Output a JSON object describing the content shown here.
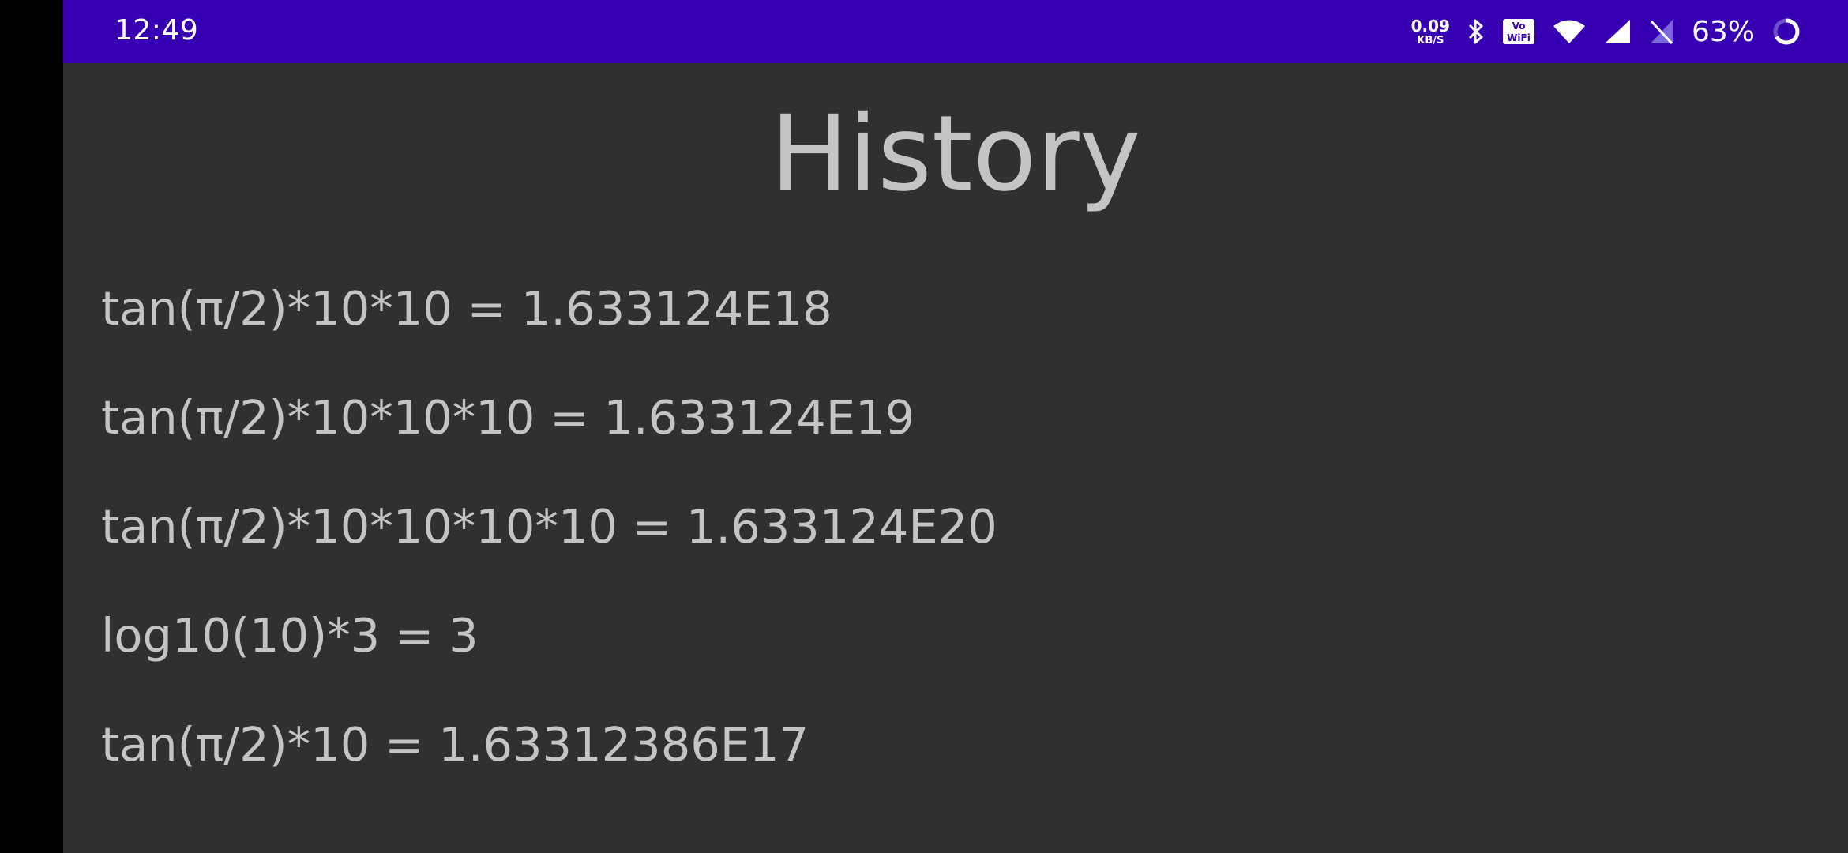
{
  "status_bar": {
    "time": "12:49",
    "net_speed_value": "0.09",
    "net_speed_unit": "KB/S",
    "vowifi_label_top": "Vo",
    "vowifi_label_bottom": "WiFi",
    "battery_percent": "63%",
    "background_color": "#3700b3",
    "icons": [
      "bluetooth-icon",
      "vowifi-icon",
      "wifi-icon",
      "cell-signal-icon",
      "no-sim-icon",
      "battery-ring-icon"
    ]
  },
  "page": {
    "title": "History",
    "background_color": "#303030",
    "text_color": "#c4c4c4"
  },
  "history": [
    "tan(π/2)*10*10 = 1.633124E18",
    "tan(π/2)*10*10*10 = 1.633124E19",
    "tan(π/2)*10*10*10*10 = 1.633124E20",
    "log10(10)*3 = 3",
    "tan(π/2)*10 = 1.63312386E17"
  ]
}
